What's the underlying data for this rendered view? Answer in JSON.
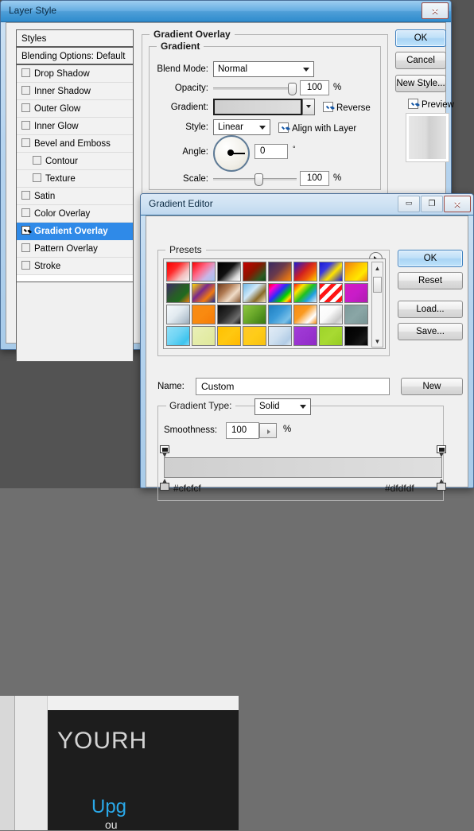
{
  "backdrop": {
    "artwork": {
      "line1": "YOURH",
      "line2": "Upg",
      "line3": "ou"
    }
  },
  "layer_style": {
    "title": "Layer Style",
    "close_glyph": "✕",
    "styles_panel": {
      "header": "Styles",
      "items": [
        {
          "label": "Blending Options: Default",
          "checkbox": false,
          "header": true,
          "indent": false,
          "selected": false
        },
        {
          "label": "Drop Shadow",
          "checkbox": true,
          "checked": false,
          "indent": false,
          "selected": false
        },
        {
          "label": "Inner Shadow",
          "checkbox": true,
          "checked": false,
          "indent": false,
          "selected": false
        },
        {
          "label": "Outer Glow",
          "checkbox": true,
          "checked": false,
          "indent": false,
          "selected": false
        },
        {
          "label": "Inner Glow",
          "checkbox": true,
          "checked": false,
          "indent": false,
          "selected": false
        },
        {
          "label": "Bevel and Emboss",
          "checkbox": true,
          "checked": false,
          "indent": false,
          "selected": false
        },
        {
          "label": "Contour",
          "checkbox": true,
          "checked": false,
          "indent": true,
          "selected": false
        },
        {
          "label": "Texture",
          "checkbox": true,
          "checked": false,
          "indent": true,
          "selected": false
        },
        {
          "label": "Satin",
          "checkbox": true,
          "checked": false,
          "indent": false,
          "selected": false
        },
        {
          "label": "Color Overlay",
          "checkbox": true,
          "checked": false,
          "indent": false,
          "selected": false
        },
        {
          "label": "Gradient Overlay",
          "checkbox": true,
          "checked": true,
          "indent": false,
          "selected": true
        },
        {
          "label": "Pattern Overlay",
          "checkbox": true,
          "checked": false,
          "indent": false,
          "selected": false
        },
        {
          "label": "Stroke",
          "checkbox": true,
          "checked": false,
          "indent": false,
          "selected": false
        }
      ]
    },
    "overlay_group_label": "Gradient Overlay",
    "gradient_group_label": "Gradient",
    "fields": {
      "blend_mode_label": "Blend Mode:",
      "blend_mode_value": "Normal",
      "opacity_label": "Opacity:",
      "opacity_value": "100",
      "opacity_unit": "%",
      "gradient_label": "Gradient:",
      "gradient_from": "#cfcfcf",
      "gradient_to": "#dfdfdf",
      "reverse_label": "Reverse",
      "reverse_checked": true,
      "style_label": "Style:",
      "style_value": "Linear",
      "align_label": "Align with Layer",
      "align_checked": true,
      "angle_label": "Angle:",
      "angle_value": "0",
      "angle_unit": "°",
      "scale_label": "Scale:",
      "scale_value": "100",
      "scale_unit": "%"
    },
    "buttons": {
      "ok": "OK",
      "cancel": "Cancel",
      "new_style": "New Style...",
      "preview_label": "Preview",
      "preview_checked": true
    }
  },
  "gradient_editor": {
    "title": "Gradient Editor",
    "minimize_glyph": "▭",
    "maximize_glyph": "❐",
    "close_glyph": "✕",
    "presets_label": "Presets",
    "presets_menu_icon": "triangle-right-icon",
    "scroll_up_icon": "▲",
    "scroll_down_icon": "▼",
    "presets": [
      {
        "name": "red-white",
        "css": "linear-gradient(135deg,#fb0000 0%,#ff2a2a 35%,#f5bdbd 70%,#f3f3f3 100%)"
      },
      {
        "name": "red-transparent",
        "css": "linear-gradient(135deg,#fb0000 0%,#ff6a8a 40%,#c9b6e8 70%,#9fc4f0 100%)"
      },
      {
        "name": "black-white",
        "css": "linear-gradient(135deg,#000000 0%,#101010 45%,#d7d7d7 80%,#ffffff 100%)"
      },
      {
        "name": "red-green",
        "css": "linear-gradient(135deg,#c60000 0%,#8a1500 45%,#2d5a21 80%,#0d4a14 100%)"
      },
      {
        "name": "violet-orange",
        "css": "linear-gradient(135deg,#3a2a63 0%,#6a3a4c 45%,#d06a1d 80%,#f08a10 100%)"
      },
      {
        "name": "blue-red-yellow",
        "css": "linear-gradient(135deg,#1a1ad6 0%,#d02020 45%,#f05a0a 70%,#ffd800 100%)"
      },
      {
        "name": "blue-yellow-blue",
        "css": "linear-gradient(135deg,#1a1ad6 0%,#3a3ae0 30%,#ffe400 60%,#1a1ad6 100%)"
      },
      {
        "name": "orange-yellow-orange",
        "css": "linear-gradient(135deg,#f07a10 0%,#ffc800 45%,#ffe800 70%,#f08a10 100%)"
      },
      {
        "name": "violet-green-orange",
        "css": "linear-gradient(135deg,#3c2a66 0%,#2a5a2a 45%,#1f6a1f 70%,#f07a10 100%)"
      },
      {
        "name": "yellow-violet-orange-blue",
        "css": "linear-gradient(135deg,#ffd800 0%,#7a2a8a 40%,#f07a10 70%,#1a2a9a 100%)"
      },
      {
        "name": "copper",
        "css": "linear-gradient(135deg,#6b3a1e 0%,#b07a52 35%,#f0dcc8 65%,#8a5a35 100%)"
      },
      {
        "name": "chrome",
        "css": "linear-gradient(135deg,#6fb8e8 0%,#cfe8f8 40%,#8a6a28 70%,#f5e8c8 100%)"
      },
      {
        "name": "spectrum",
        "css": "linear-gradient(135deg,#ff0000 0%,#ff00d0 20%,#2a2aff 45%,#00d000 70%,#ffe400 85%,#ff0000 100%)"
      },
      {
        "name": "transparent-rainbow",
        "css": "linear-gradient(135deg,#ff1010 0%,#ffe400 25%,#20c020 50%,#20a0e0 72%,#e8eef8 100%)"
      },
      {
        "name": "transparent-stripes",
        "css": "repeating-linear-gradient(135deg,#ff1414 0 5px,#ffffff 5px 10px)"
      },
      {
        "name": "magenta-purple",
        "css": "linear-gradient(135deg,#d41cc0 0%,#c81cc8 50%,#b01ab0 100%)"
      },
      {
        "name": "steel-white",
        "css": "linear-gradient(135deg,#f4f8fb 0%,#e2eaf0 45%,#b8c6d2 80%,#9aa8b6 100%)"
      },
      {
        "name": "orange-solid",
        "css": "linear-gradient(135deg,#f78a14 0%,#f98a10 50%,#f57a08 100%)"
      },
      {
        "name": "black-gray",
        "css": "linear-gradient(135deg,#0a0a0a 0%,#2c2c2c 45%,#6e6e6e 78%,#121212 100%)"
      },
      {
        "name": "green-noise",
        "css": "linear-gradient(135deg,#8ec63f 0%,#6aa82a 45%,#4a8a1a 80%,#3a7a12 100%)"
      },
      {
        "name": "blue-light",
        "css": "linear-gradient(135deg,#1f7fc0 0%,#3a9ad8 45%,#79c0e8 80%,#2a86c8 100%)"
      },
      {
        "name": "orange-white",
        "css": "linear-gradient(135deg,#f78a14 0%,#fa9a20 40%,#ffffff 75%,#f58a10 100%)"
      },
      {
        "name": "white-gray",
        "css": "linear-gradient(135deg,#ffffff 0%,#fafafa 45%,#c8c8c8 80%,#e8e8e8 100%)"
      },
      {
        "name": "slate-teal",
        "css": "linear-gradient(135deg,#7d9a9a 0%,#8aa6a6 50%,#789494 100%)"
      },
      {
        "name": "cyan-light",
        "css": "linear-gradient(135deg,#8fe0f8 0%,#6fd4f4 45%,#3ec4ee 80%,#7ad8f6 100%)"
      },
      {
        "name": "pale-yellow",
        "css": "linear-gradient(135deg,#eaf0b8 0%,#e4eca8 50%,#dfe89a 100%)"
      },
      {
        "name": "amber",
        "css": "linear-gradient(135deg,#ffc000 0%,#ffc810 50%,#ffb800 100%)"
      },
      {
        "name": "gold",
        "css": "linear-gradient(135deg,#ffc828 0%,#ffcc18 50%,#f8c010 100%)"
      },
      {
        "name": "pale-blue",
        "css": "linear-gradient(135deg,#e2ecf6 0%,#cfe0f0 45%,#b2cce6 80%,#dbe8f4 100%)"
      },
      {
        "name": "purple",
        "css": "linear-gradient(135deg,#a23cd8 0%,#9a34d0 50%,#8f2ac6 100%)"
      },
      {
        "name": "lime",
        "css": "linear-gradient(135deg,#9ed42a 0%,#a8da32 50%,#96cc22 100%)"
      },
      {
        "name": "black-fade",
        "css": "linear-gradient(135deg,#000000 0%,#080808 50%,#1a1a1a 80%,#000000 100%)"
      }
    ],
    "name_label": "Name:",
    "name_value": "Custom",
    "new_button": "New",
    "gradient_type_label": "Gradient Type:",
    "gradient_type_value": "Solid",
    "smoothness_label": "Smoothness:",
    "smoothness_value": "100",
    "smoothness_unit": "%",
    "gradient_bar": {
      "from": "#cfcfcf",
      "to": "#dfdfdf"
    },
    "stops": {
      "left_hex": "#cfcfcf",
      "right_hex": "#dfdfdf"
    },
    "buttons": {
      "ok": "OK",
      "reset": "Reset",
      "load": "Load...",
      "save": "Save..."
    }
  }
}
